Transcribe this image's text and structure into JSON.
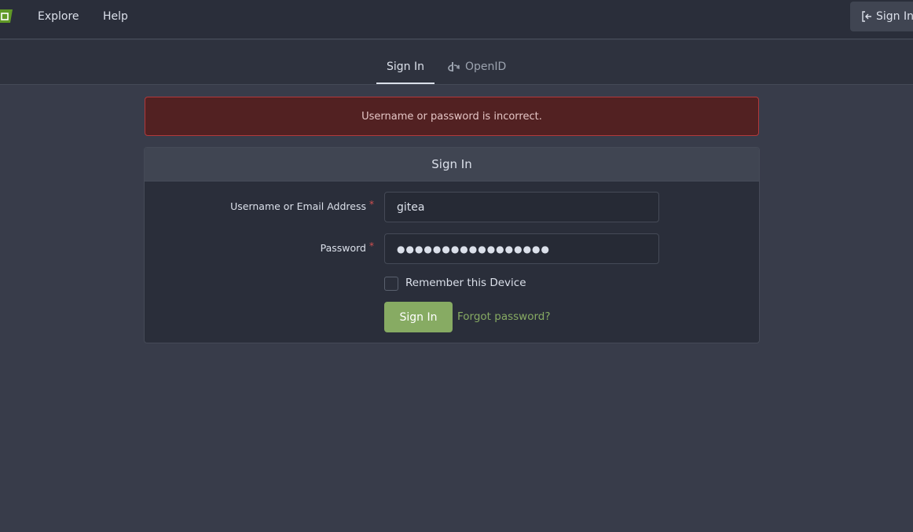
{
  "navbar": {
    "logo": "gitea-logo-icon",
    "links": [
      "Explore",
      "Help"
    ],
    "signin_label": "Sign In"
  },
  "tabs": {
    "signin": "Sign In",
    "openid": "OpenID"
  },
  "alert": {
    "message": "Username or password is incorrect."
  },
  "form": {
    "title": "Sign In",
    "username_label": "Username or Email Address",
    "username_value": "gitea",
    "password_label": "Password",
    "password_value": "●●●●●●●●●●●●●●●●●",
    "required_mark": "*",
    "remember_label": "Remember this Device",
    "submit_label": "Sign In",
    "forgot_label": "Forgot password?"
  },
  "colors": {
    "accent": "#87ab63",
    "error_bg": "#522122",
    "error_border": "#b2393b",
    "background": "#383c4a"
  }
}
